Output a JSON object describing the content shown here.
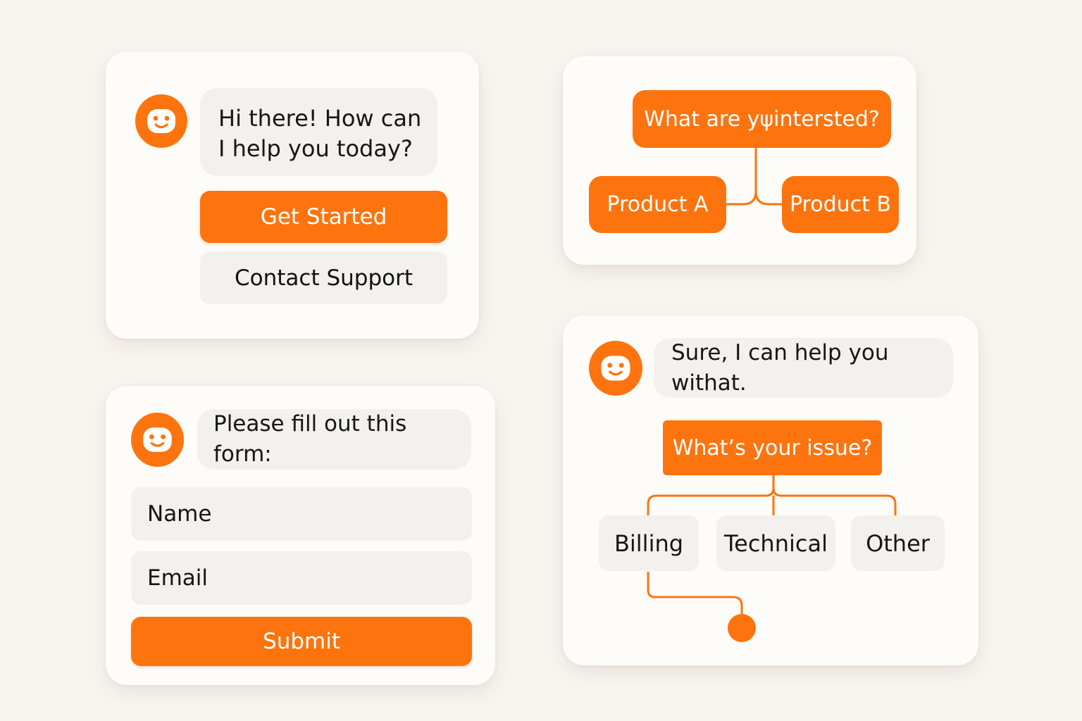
{
  "welcome_card": {
    "greeting_line1": "Hi there! How can",
    "greeting_line2": "I help you today?",
    "get_started_label": "Get Started",
    "contact_support_label": "Contact Support"
  },
  "interest_card": {
    "question": "What are yψintersted?",
    "option_a": "Product A",
    "option_b": "Product B"
  },
  "form_card": {
    "prompt": "Please fill out this form:",
    "name_field": "Name",
    "email_field": "Email",
    "submit_label": "Submit"
  },
  "issue_card": {
    "reply": "Sure, I can help you withat.",
    "question": "What’s your issue?",
    "options": [
      "Billing",
      "Technical",
      "Other"
    ]
  },
  "icons": {
    "avatar": "smiley-face-icon"
  },
  "colors": {
    "accent": "#fd740f",
    "background": "#f8f5f0",
    "card": "#fdfcf9",
    "chip": "#f3f1ee"
  }
}
